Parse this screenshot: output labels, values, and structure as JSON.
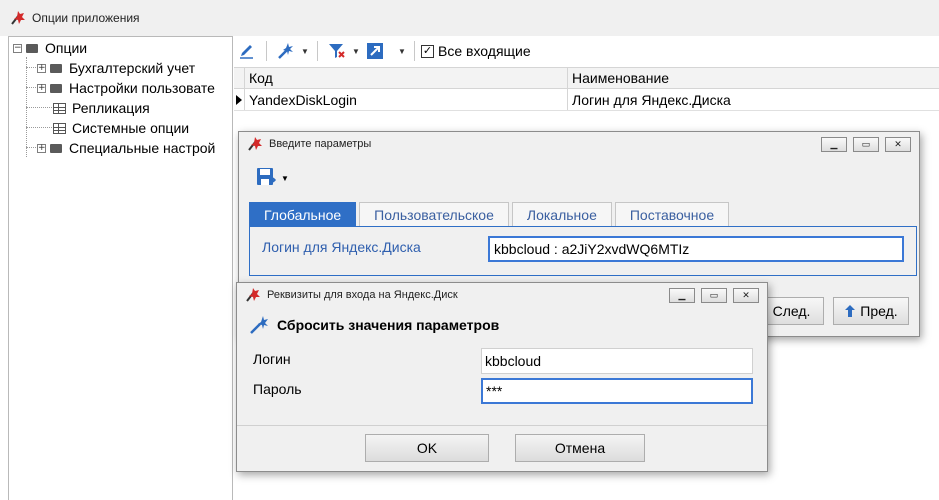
{
  "app": {
    "title": "Опции приложения"
  },
  "tree": {
    "root": "Опции",
    "items": [
      {
        "label": "Бухгалтерский учет",
        "type": "folder",
        "expandable": true
      },
      {
        "label": "Настройки пользовате",
        "type": "folder",
        "expandable": true
      },
      {
        "label": "Репликация",
        "type": "table",
        "expandable": false
      },
      {
        "label": "Системные опции",
        "type": "table",
        "expandable": false
      },
      {
        "label": "Специальные настрой",
        "type": "folder",
        "expandable": true
      }
    ]
  },
  "toolbar": {
    "checkbox_label": "Все входящие",
    "checkbox_checked": true
  },
  "grid": {
    "columns": [
      "Код",
      "Наименование"
    ],
    "rows": [
      {
        "code": "YandexDiskLogin",
        "name": "Логин для Яндекс.Диска"
      }
    ]
  },
  "params_dialog": {
    "title": "Введите параметры",
    "tabs": [
      "Глобальное",
      "Пользовательское",
      "Локальное",
      "Поставочное"
    ],
    "active_tab": 0,
    "field_label": "Логин для Яндекс.Диска",
    "field_value": "kbbcloud : a2JiY2xvdWQ6MTIz",
    "next_label": "След.",
    "prev_label": "Пред."
  },
  "cred_dialog": {
    "title": "Реквизиты для входа на Яндекс.Диск",
    "reset_label": "Сбросить значения параметров",
    "login_label": "Логин",
    "login_value": "kbbcloud",
    "password_label": "Пароль",
    "password_value": "***",
    "ok_label": "OK",
    "cancel_label": "Отмена"
  },
  "colors": {
    "accent": "#2f6fc6",
    "link_text": "#2f5fae",
    "focus": "#3b78d6",
    "app_icon": "#d42a2a"
  }
}
